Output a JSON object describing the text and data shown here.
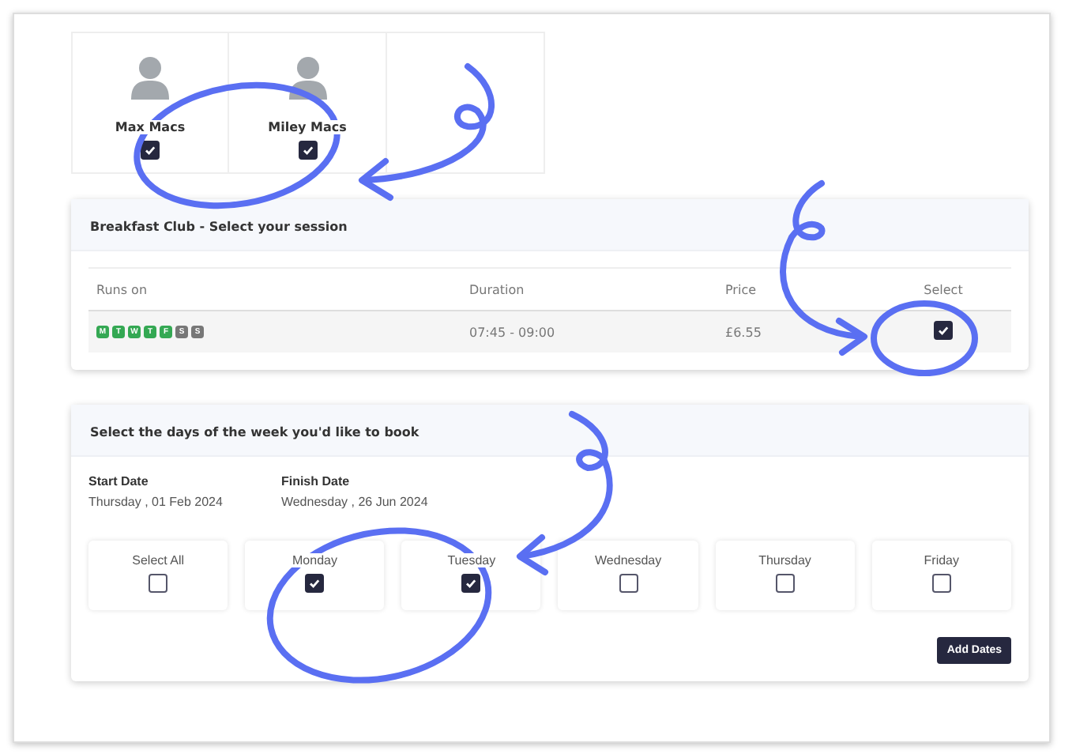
{
  "children": [
    {
      "name": "Max Macs",
      "selected": true
    },
    {
      "name": "Miley Macs",
      "selected": true
    }
  ],
  "session": {
    "title": "Breakfast Club - Select your session",
    "columns": [
      "Runs on",
      "Duration",
      "Price",
      "Select"
    ],
    "rows": [
      {
        "days": [
          {
            "letter": "M",
            "available": true
          },
          {
            "letter": "T",
            "available": true
          },
          {
            "letter": "W",
            "available": true
          },
          {
            "letter": "T",
            "available": true
          },
          {
            "letter": "F",
            "available": true
          },
          {
            "letter": "S",
            "available": false
          },
          {
            "letter": "S",
            "available": false
          }
        ],
        "duration": "07:45 - 09:00",
        "price": "£6.55",
        "selected": true
      }
    ]
  },
  "booking": {
    "title": "Select the days of the week you'd like to book",
    "start_label": "Start Date",
    "start_value": "Thursday , 01 Feb 2024",
    "finish_label": "Finish Date",
    "finish_value": "Wednesday , 26 Jun 2024",
    "days": [
      {
        "label": "Select All",
        "checked": false
      },
      {
        "label": "Monday",
        "checked": true
      },
      {
        "label": "Tuesday",
        "checked": true
      },
      {
        "label": "Wednesday",
        "checked": false
      },
      {
        "label": "Thursday",
        "checked": false
      },
      {
        "label": "Friday",
        "checked": false
      }
    ],
    "button": "Add Dates"
  }
}
